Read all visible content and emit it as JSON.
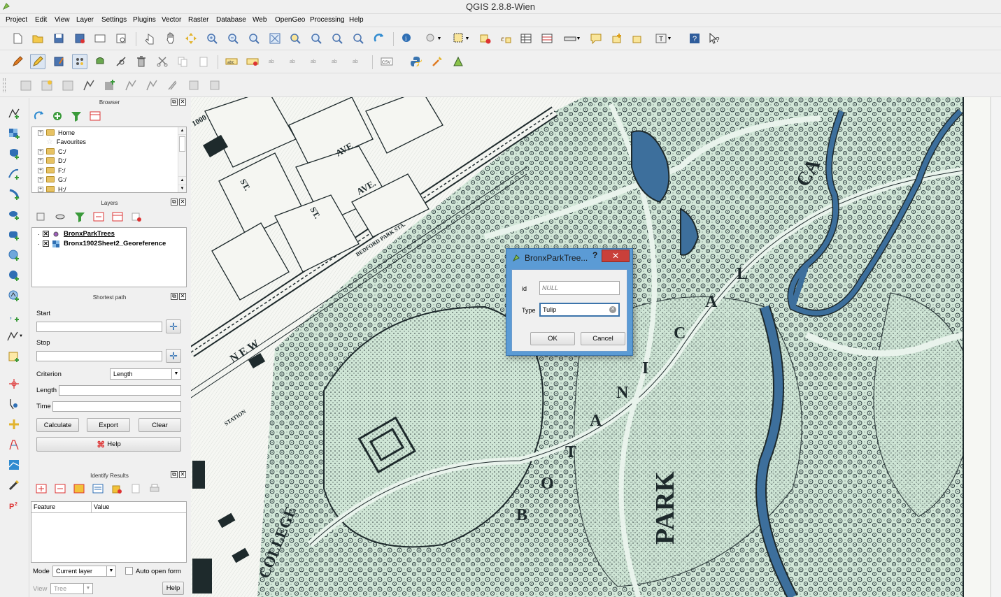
{
  "app": {
    "title": "QGIS 2.8.8-Wien"
  },
  "menu": [
    "Project",
    "Edit",
    "View",
    "Layer",
    "Settings",
    "Plugins",
    "Vector",
    "Raster",
    "Database",
    "Web",
    "OpenGeo",
    "Processing",
    "Help"
  ],
  "browser": {
    "title": "Browser",
    "items": [
      "Home",
      "Favourites",
      "C:/",
      "D:/",
      "F:/",
      "G:/",
      "H:/"
    ]
  },
  "layers": {
    "title": "Layers",
    "items": [
      "BronxParkTrees",
      "Bronx1902Sheet2_Georeference"
    ]
  },
  "shortest_path": {
    "title": "Shortest path",
    "start_label": "Start",
    "stop_label": "Stop",
    "criterion_label": "Criterion",
    "criterion_value": "Length",
    "length_label": "Length",
    "time_label": "Time",
    "calculate": "Calculate",
    "export": "Export",
    "clear": "Clear",
    "help": "Help"
  },
  "identify": {
    "title": "Identify Results",
    "col_feature": "Feature",
    "col_value": "Value",
    "mode_label": "Mode",
    "mode_value": "Current layer",
    "auto_open": "Auto open form",
    "view_label": "View",
    "view_value": "Tree",
    "help": "Help"
  },
  "dialog": {
    "title": "BronxParkTree...",
    "help_glyph": "?",
    "close_glyph": "✕",
    "id_label": "id",
    "id_placeholder": "NULL",
    "type_label": "Type",
    "type_value": "Tulip",
    "ok": "OK",
    "cancel": "Cancel"
  },
  "map_labels": {
    "ave1": "AVE",
    "ave2": "AVE.",
    "st1": "ST.",
    "st2": "ST.",
    "bedford": "BEDFORD PARK STA.",
    "botanical_b": "B",
    "botanical_o": "O",
    "botanical_t": "T",
    "botanical_a": "A",
    "botanical_n": "N",
    "botanical_i": "I",
    "botanical_c": "C",
    "botanical_a2": "A",
    "botanical_l": "L",
    "park": "PARK",
    "college": "COLLEGE",
    "new": "N E W",
    "ca": "CA",
    "num1000": "1000",
    "station": "STATION"
  },
  "colors": {
    "map_green": "#cfe6d6",
    "map_ink": "#1e2a2c",
    "river": "#3d6f9c",
    "dialog_frame": "#5b9bd5",
    "close_red": "#c9403a"
  }
}
